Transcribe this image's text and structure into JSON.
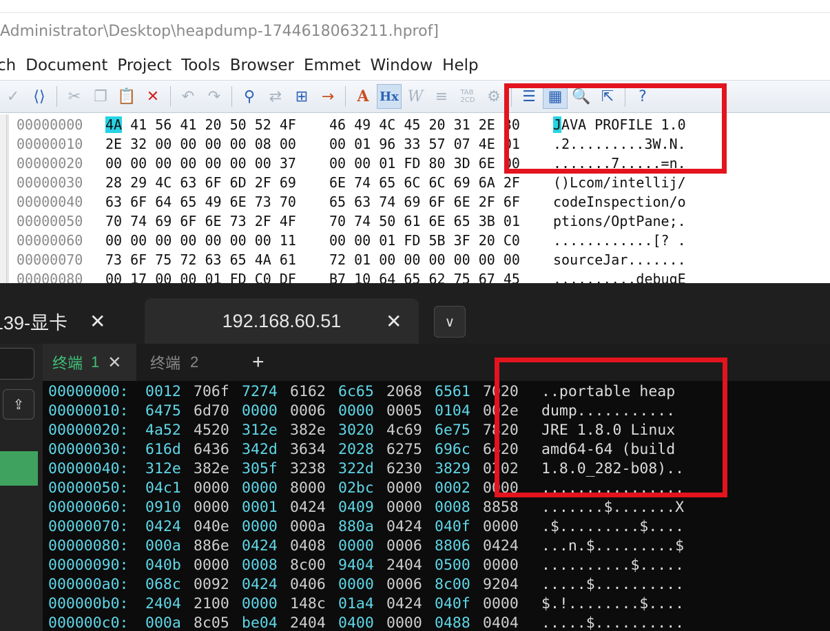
{
  "editor": {
    "title": "Administrator\\Desktop\\heapdump-1744618063211.hprof]",
    "menu": [
      "ch",
      "Document",
      "Project",
      "Tools",
      "Browser",
      "Emmet",
      "Window",
      "Help"
    ],
    "toolbar_icons": [
      "spellcheck-icon",
      "code-tag-icon",
      "cut-icon",
      "copy-icon",
      "paste-icon",
      "delete-icon",
      "undo-icon",
      "redo-icon",
      "find-icon",
      "replace-icon",
      "find-in-files-icon",
      "goto-line-icon",
      "font-size-icon",
      "hex-mode-icon",
      "word-wrap-icon",
      "column-icon",
      "abc-convert-icon",
      "settings-icon",
      "list-icon",
      "panel-icon",
      "search-doc-icon",
      "open-browser-icon",
      "help-icon"
    ],
    "hex_rows": [
      {
        "offset": "00000000",
        "b1": "4A 41 56 41 20 50 52 4F",
        "b2": "46 49 4C 45 20 31 2E 30",
        "ascii": "JAVA PROFILE 1.0"
      },
      {
        "offset": "00000010",
        "b1": "2E 32 00 00 00 00 08 00",
        "b2": "00 01 96 33 57 07 4E 01",
        "ascii": ".2.........3W.N."
      },
      {
        "offset": "00000020",
        "b1": "00 00 00 00 00 00 00 37",
        "b2": "00 00 01 FD 80 3D 6E 00",
        "ascii": ".......7.....=n."
      },
      {
        "offset": "00000030",
        "b1": "28 29 4C 63 6F 6D 2F 69",
        "b2": "6E 74 65 6C 6C 69 6A 2F",
        "ascii": "()Lcom/intellij/"
      },
      {
        "offset": "00000040",
        "b1": "63 6F 64 65 49 6E 73 70",
        "b2": "65 63 74 69 6F 6E 2F 6F",
        "ascii": "codeInspection/o"
      },
      {
        "offset": "00000050",
        "b1": "70 74 69 6F 6E 73 2F 4F",
        "b2": "70 74 50 61 6E 65 3B 01",
        "ascii": "ptions/OptPane;."
      },
      {
        "offset": "00000060",
        "b1": "00 00 00 00 00 00 00 11",
        "b2": "00 00 01 FD 5B 3F 20 C0",
        "ascii": "............[? ."
      },
      {
        "offset": "00000070",
        "b1": "73 6F 75 72 63 65 4A 61",
        "b2": "72 01 00 00 00 00 00 00",
        "ascii": "sourceJar......."
      },
      {
        "offset": "00000080",
        "b1": "00 17 00 00 01 FD C0 DF",
        "b2": "B7 10 64 65 62 75 67 45",
        "ascii": "..........debugE"
      }
    ]
  },
  "terminal": {
    "tab1_label": "139-显卡",
    "tab2_label": "192.168.60.51",
    "close_glyph": "✕",
    "dropdown_glyph": "∨",
    "upload_glyph": "⇪",
    "subtab1_label": "终端",
    "subtab1_num": "1",
    "subtab2_label": "终端",
    "subtab2_num": "2",
    "add_glyph": "+",
    "rows": [
      {
        "offset": "00000000:",
        "words": [
          "0012",
          "706f",
          "7274",
          "6162",
          "6c65",
          "2068",
          "6561",
          "7020"
        ],
        "ascii": "..portable heap"
      },
      {
        "offset": "00000010:",
        "words": [
          "6475",
          "6d70",
          "0000",
          "0006",
          "0000",
          "0005",
          "0104",
          "002e"
        ],
        "ascii": "dump..........."
      },
      {
        "offset": "00000020:",
        "words": [
          "4a52",
          "4520",
          "312e",
          "382e",
          "3020",
          "4c69",
          "6e75",
          "7820"
        ],
        "ascii": "JRE 1.8.0 Linux"
      },
      {
        "offset": "00000030:",
        "words": [
          "616d",
          "6436",
          "342d",
          "3634",
          "2028",
          "6275",
          "696c",
          "6420"
        ],
        "ascii": "amd64-64 (build"
      },
      {
        "offset": "00000040:",
        "words": [
          "312e",
          "382e",
          "305f",
          "3238",
          "322d",
          "6230",
          "3829",
          "0202"
        ],
        "ascii": "1.8.0_282-b08).."
      },
      {
        "offset": "00000050:",
        "words": [
          "04c1",
          "0000",
          "0000",
          "8000",
          "02bc",
          "0000",
          "0002",
          "0000"
        ],
        "ascii": "................"
      },
      {
        "offset": "00000060:",
        "words": [
          "0910",
          "0000",
          "0001",
          "0424",
          "0409",
          "0000",
          "0008",
          "8858"
        ],
        "ascii": ".......$.......X"
      },
      {
        "offset": "00000070:",
        "words": [
          "0424",
          "040e",
          "0000",
          "000a",
          "880a",
          "0424",
          "040f",
          "0000"
        ],
        "ascii": ".$.........$...."
      },
      {
        "offset": "00000080:",
        "words": [
          "000a",
          "886e",
          "0424",
          "0408",
          "0000",
          "0006",
          "8806",
          "0424"
        ],
        "ascii": "...n.$.........$"
      },
      {
        "offset": "00000090:",
        "words": [
          "040b",
          "0000",
          "0008",
          "8c00",
          "9404",
          "2404",
          "0500",
          "0000"
        ],
        "ascii": "..........$....."
      },
      {
        "offset": "000000a0:",
        "words": [
          "068c",
          "0092",
          "0424",
          "0406",
          "0000",
          "0006",
          "8c00",
          "9204"
        ],
        "ascii": ".....$.........."
      },
      {
        "offset": "000000b0:",
        "words": [
          "2404",
          "2100",
          "0000",
          "148c",
          "01a4",
          "0424",
          "040f",
          "0000"
        ],
        "ascii": "$.!........$...."
      },
      {
        "offset": "000000c0:",
        "words": [
          "000a",
          "8c05",
          "be04",
          "2404",
          "0400",
          "0000",
          "0488",
          "0404"
        ],
        "ascii": ".....$.........."
      }
    ]
  },
  "colors": {
    "annotation_red": "#e3141e",
    "terminal_cyan": "#5fd7e8",
    "tab_active_green": "#3fc177",
    "hex_highlight": "#27d3e5"
  }
}
